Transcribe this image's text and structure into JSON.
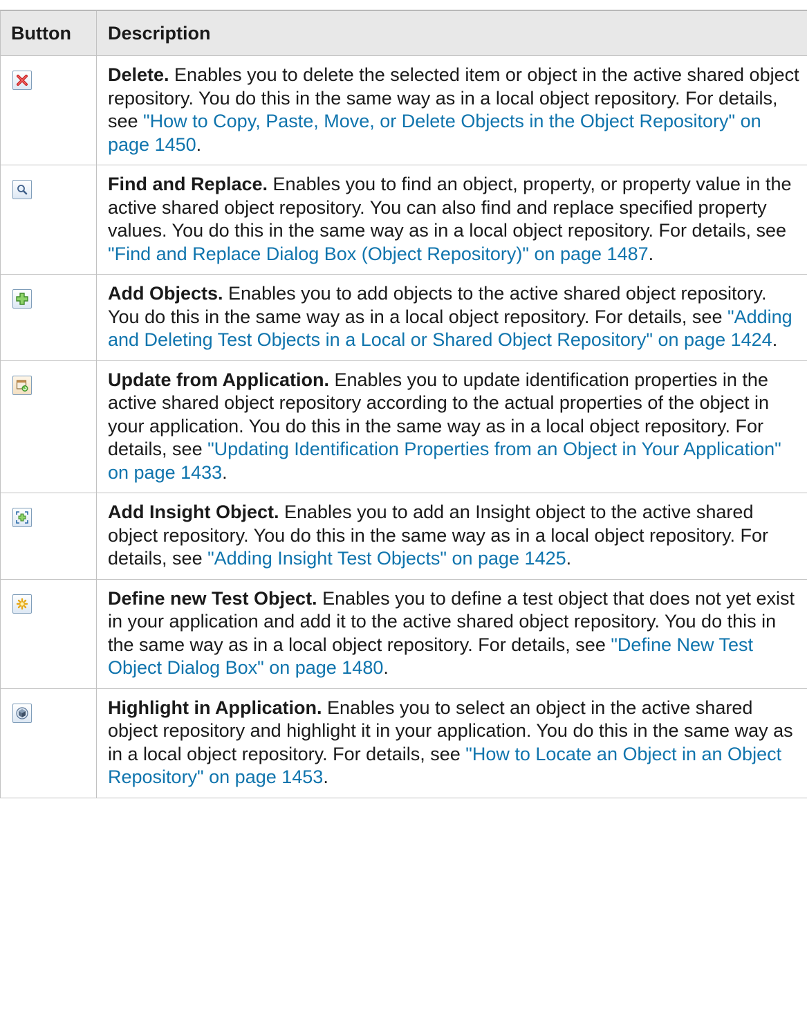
{
  "table": {
    "headers": {
      "button": "Button",
      "description": "Description"
    },
    "rows": [
      {
        "icon": "delete-icon",
        "title": "Delete.",
        "text": " Enables you to delete the selected item or object in the active shared object repository. You do this in the same way as in a local object repository. For details, see ",
        "link": "\"How to Copy, Paste, Move, or Delete Objects in the Object Repository\" on page 1450",
        "tail": "."
      },
      {
        "icon": "find-replace-icon",
        "title": "Find and Replace.",
        "text": " Enables you to find an object, property, or property value in the active shared object repository. You can also find and replace specified property values. You do this in the same way as in a local object repository. For details, see ",
        "link": "\"Find and Replace Dialog Box (Object Repository)\" on page 1487",
        "tail": "."
      },
      {
        "icon": "add-objects-icon",
        "title": "Add Objects.",
        "text": " Enables you to add objects to the active shared object repository. You do this in the same way as in a local object repository. For details, see ",
        "link": "\"Adding and Deleting Test Objects in a Local or Shared Object Repository\" on page 1424",
        "tail": "."
      },
      {
        "icon": "update-from-application-icon",
        "title": "Update from Application.",
        "text": " Enables you to update identification properties in the active shared object repository according to the actual properties of the object in your application. You do this in the same way as in a local object repository. For details, see ",
        "link": "\"Updating Identification Properties from an Object in Your Application\" on page 1433",
        "tail": "."
      },
      {
        "icon": "add-insight-object-icon",
        "title": "Add Insight Object.",
        "text": " Enables you to add an Insight object to the active shared object repository. You do this in the same way as in a local object repository. For details, see ",
        "link": "\"Adding Insight Test Objects\" on page 1425",
        "tail": "."
      },
      {
        "icon": "define-new-test-object-icon",
        "title": "Define new Test Object.",
        "text": " Enables you to define a test object that does not yet exist in your application and add it to the active shared object repository. You do this in the same way as in a local object repository. For details, see ",
        "link": "\"Define New Test Object Dialog Box\" on page 1480",
        "tail": "."
      },
      {
        "icon": "highlight-in-application-icon",
        "title": "Highlight in Application.",
        "text": " Enables you to select an object in the active shared object repository and highlight it in your application. You do this in the same way as in a local object repository. For details, see ",
        "link": "\"How to Locate an Object in an Object Repository\" on page 1453",
        "tail": "."
      }
    ]
  },
  "colors": {
    "link": "#0f74ad",
    "header_bg": "#e8e8e8",
    "border": "#c2c2c2"
  }
}
